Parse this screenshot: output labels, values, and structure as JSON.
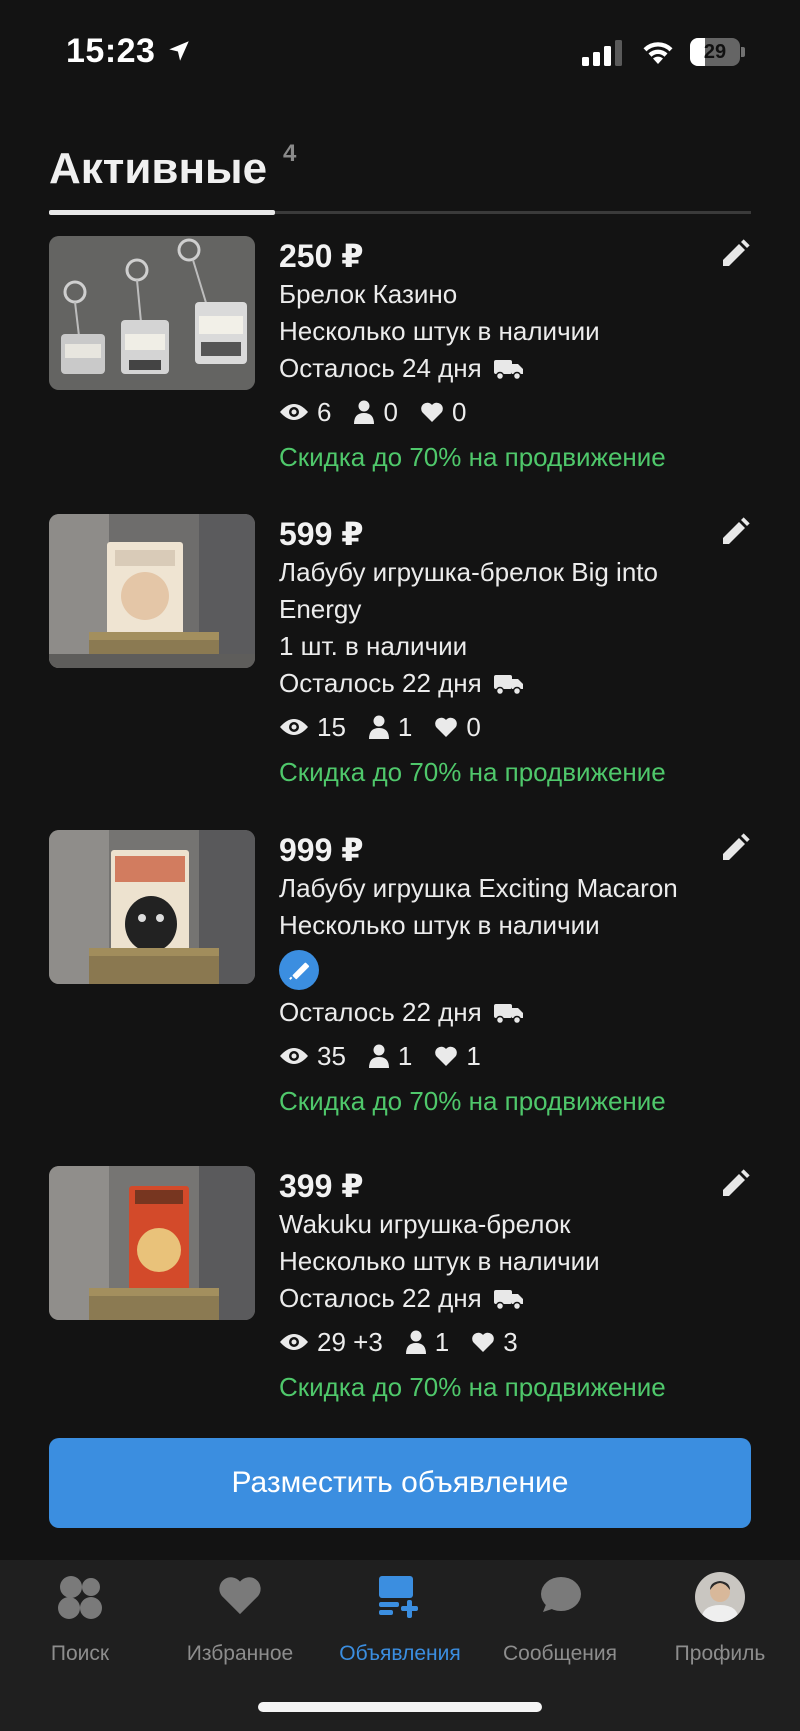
{
  "status": {
    "time": "15:23",
    "battery": "29",
    "battery_level": 0.29
  },
  "tabs": {
    "active_label": "Активные",
    "active_count": "4"
  },
  "listings": [
    {
      "price": "250 ₽",
      "title": "Брелок Казино",
      "stock": "Несколько штук в наличии",
      "remaining": "Осталось 24 дня",
      "views": "6",
      "contacts": "0",
      "likes": "0",
      "promo": "Скидка до 70% на продвижение"
    },
    {
      "price": "599 ₽",
      "title": "Лабубу игрушка-брелок Big into Energy",
      "stock": "1 шт. в наличии",
      "remaining": "Осталось 22 дня",
      "views": "15",
      "contacts": "1",
      "likes": "0",
      "promo": "Скидка до 70% на продвижение"
    },
    {
      "price": "999 ₽",
      "title": "Лабубу игрушка Exciting Macaron",
      "stock": "Несколько штук в наличии",
      "remaining": "Осталось 22 дня",
      "views": "35",
      "contacts": "1",
      "likes": "1",
      "promo": "Скидка до 70% на продвижение"
    },
    {
      "price": "399 ₽",
      "title": "Wakuku игрушка-брелок",
      "stock": "Несколько штук в наличии",
      "remaining": "Осталось 22 дня",
      "views": "29 +3",
      "contacts": "1",
      "likes": "3",
      "promo": "Скидка до 70% на продвижение"
    }
  ],
  "post_button": "Разместить объявление",
  "nav": {
    "search": "Поиск",
    "favorites": "Избранное",
    "listings": "Объявления",
    "messages": "Сообщения",
    "profile": "Профиль"
  },
  "colors": {
    "accent": "#3b8ee0",
    "promo": "#4fc86b",
    "background": "#131313"
  }
}
